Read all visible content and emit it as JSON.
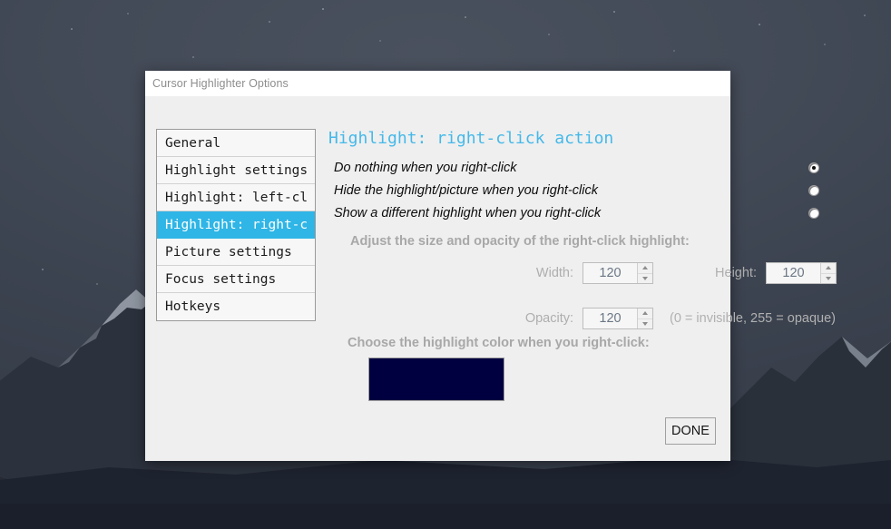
{
  "window": {
    "title": "Cursor Highlighter Options"
  },
  "sidebar": {
    "items": [
      {
        "label": "General",
        "selected": false
      },
      {
        "label": "Highlight settings",
        "selected": false
      },
      {
        "label": "Highlight: left-cl",
        "selected": false
      },
      {
        "label": "Highlight: right-c",
        "selected": true
      },
      {
        "label": "Picture settings",
        "selected": false
      },
      {
        "label": "Focus settings",
        "selected": false
      },
      {
        "label": "Hotkeys",
        "selected": false
      }
    ]
  },
  "pane": {
    "heading": "Highlight: right-click action",
    "radios": [
      {
        "label": "Do nothing when you right-click",
        "checked": true
      },
      {
        "label": "Hide the highlight/picture when you right-click",
        "checked": false
      },
      {
        "label": "Show a different highlight when you right-click",
        "checked": false
      }
    ],
    "adjust_caption": "Adjust the size and opacity of the right-click highlight:",
    "fields": {
      "width_label": "Width:",
      "width_value": "120",
      "height_label": "Height:",
      "height_value": "120",
      "opacity_label": "Opacity:",
      "opacity_value": "120",
      "opacity_hint": "(0 = invisible, 255 = opaque)"
    },
    "color_caption": "Choose the highlight color when you right-click:",
    "color_value": "#000040"
  },
  "footer": {
    "done_label": "DONE"
  },
  "colors": {
    "accent": "#45b9e9",
    "selection": "#2fb5e6",
    "swatch": "#000040",
    "disabled_text": "#aeaeae"
  }
}
